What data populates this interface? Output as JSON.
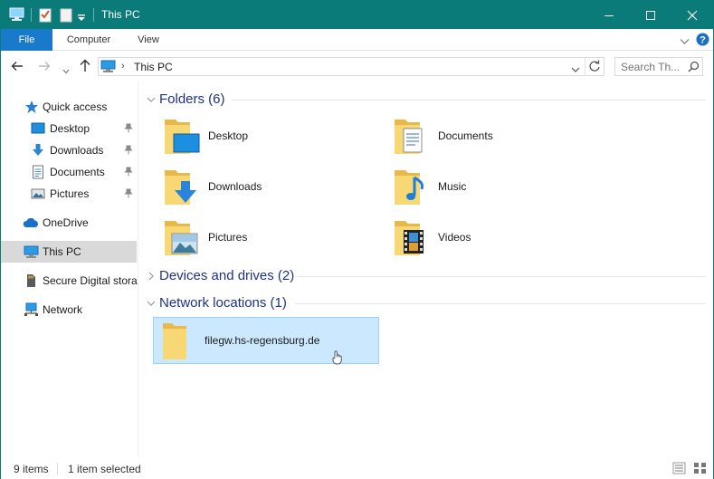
{
  "window": {
    "title": "This PC"
  },
  "ribbon": {
    "tabs": [
      "File",
      "Computer",
      "View"
    ]
  },
  "address": {
    "location": "This PC"
  },
  "search": {
    "placeholder": "Search Th..."
  },
  "sidebar": {
    "items": [
      {
        "label": "Quick access",
        "icon": "star-icon"
      },
      {
        "label": "Desktop",
        "icon": "desktop-icon",
        "pinned": true
      },
      {
        "label": "Downloads",
        "icon": "download-arrow-icon",
        "pinned": true
      },
      {
        "label": "Documents",
        "icon": "document-icon",
        "pinned": true
      },
      {
        "label": "Pictures",
        "icon": "picture-icon",
        "pinned": true
      },
      {
        "label": "OneDrive",
        "icon": "cloud-icon"
      },
      {
        "label": "This PC",
        "icon": "computer-icon",
        "selected": true
      },
      {
        "label": "Secure Digital storag",
        "icon": "sd-card-icon"
      },
      {
        "label": "Network",
        "icon": "network-icon"
      }
    ]
  },
  "groups": {
    "folders": {
      "title": "Folders (6)",
      "expanded": true
    },
    "devices": {
      "title": "Devices and drives (2)",
      "expanded": false
    },
    "network": {
      "title": "Network locations (1)",
      "expanded": true
    }
  },
  "folders": [
    {
      "label": "Desktop",
      "icon": "desktop-folder-icon"
    },
    {
      "label": "Documents",
      "icon": "documents-folder-icon"
    },
    {
      "label": "Downloads",
      "icon": "downloads-folder-icon"
    },
    {
      "label": "Music",
      "icon": "music-folder-icon"
    },
    {
      "label": "Pictures",
      "icon": "pictures-folder-icon"
    },
    {
      "label": "Videos",
      "icon": "videos-folder-icon"
    }
  ],
  "network_locations": [
    {
      "label": "filegw.hs-regensburg.de",
      "icon": "network-folder-icon",
      "selected": true
    }
  ],
  "status": {
    "items": "9 items",
    "selected": "1 item selected"
  },
  "colors": {
    "titlebar": "#0b7b7a",
    "file_tab": "#1979ca",
    "group_title": "#1e3287",
    "selection": "#cce8ff",
    "folder": "#f8d775"
  }
}
